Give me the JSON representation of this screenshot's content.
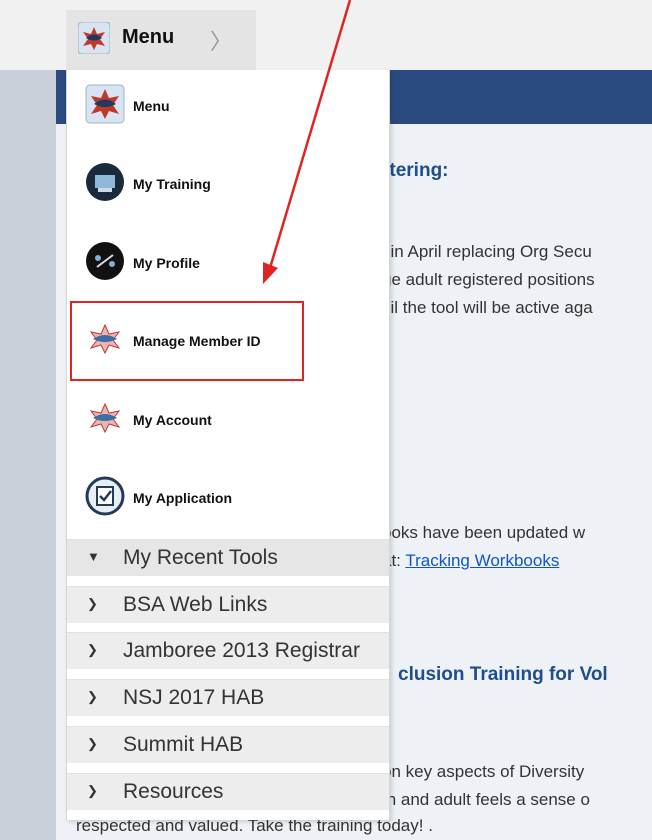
{
  "header": {
    "menu_label": "Menu",
    "chevron": "〉"
  },
  "menu": {
    "items": [
      {
        "label": "Menu",
        "icon": "bsa-emblem-icon"
      },
      {
        "label": "My Training",
        "icon": "training-icon"
      },
      {
        "label": "My Profile",
        "icon": "profile-icon"
      },
      {
        "label": "Manage Member ID",
        "icon": "bsa-emblem-icon"
      },
      {
        "label": "My Account",
        "icon": "bsa-emblem-icon"
      },
      {
        "label": "My Application",
        "icon": "checklist-icon"
      }
    ],
    "groups": [
      {
        "label": "My Recent Tools",
        "expanded": true
      },
      {
        "label": "BSA Web Links",
        "expanded": false
      },
      {
        "label": "Jamboree 2013 Registrar",
        "expanded": false
      },
      {
        "label": "NSJ 2017 HAB",
        "expanded": false
      },
      {
        "label": "Summit HAB",
        "expanded": false
      },
      {
        "label": "Resources",
        "expanded": false
      }
    ]
  },
  "content": {
    "heading1": "rtering:",
    "line1": "l in April replacing Org Secu",
    "line2": "ge adult registered positions",
    "line3": "cil the tool will be active aga",
    "line4": "ooks have been updated w",
    "line5_prefix": "at: ",
    "line5_link": "Tracking Workbooks",
    "heading2": "clusion Training for Vol",
    "line6": "on key aspects of Diversity",
    "line7": "th and adult feels a sense o",
    "line8": "respected and valued. Take the training today! ."
  },
  "colors": {
    "header_blue": "#2a4a7f",
    "highlight": "#e02424",
    "link": "#1155cc"
  }
}
